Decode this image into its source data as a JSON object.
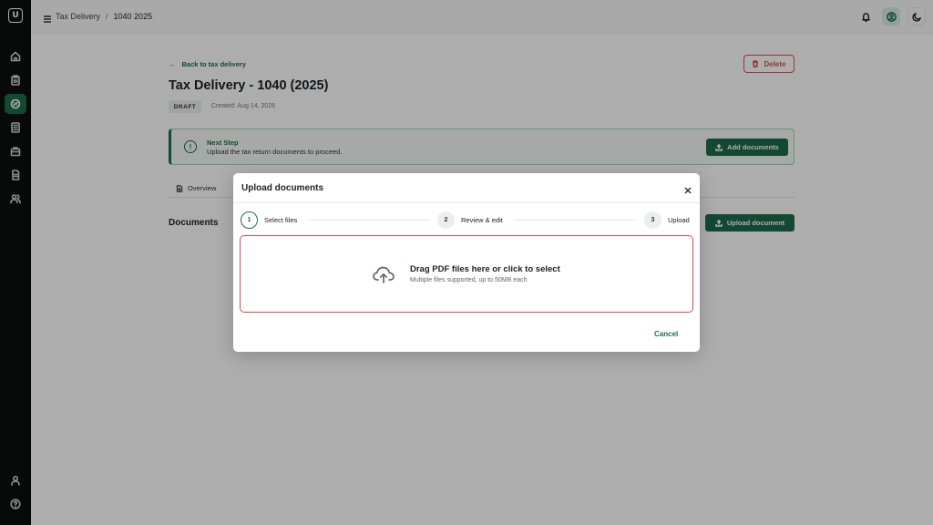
{
  "sidebar": {
    "logo_letter": "U",
    "items": [
      {
        "icon": "home-icon"
      },
      {
        "icon": "clipboard-icon"
      },
      {
        "icon": "tax-delivery-icon"
      },
      {
        "icon": "calculator-icon"
      },
      {
        "icon": "briefcase-icon"
      },
      {
        "icon": "document-icon"
      },
      {
        "icon": "users-icon"
      }
    ],
    "bottom": [
      {
        "icon": "user-icon"
      },
      {
        "icon": "help-icon"
      }
    ]
  },
  "topbar": {
    "breadcrumb_parent": "Tax Delivery",
    "breadcrumb_separator": "/",
    "breadcrumb_current": "1040 2025"
  },
  "page": {
    "back_link": "Back to tax delivery",
    "delete_label": "Delete",
    "title": "Tax Delivery - 1040 (2025)",
    "status_badge": "DRAFT",
    "created": "Created: Aug 14, 2026",
    "next_step_title": "Next Step",
    "next_step_text": "Upload the tax return documents to proceed.",
    "add_documents_label": "Add documents",
    "tab_overview": "Overview",
    "documents_heading": "Documents",
    "upload_document_label": "Upload document"
  },
  "modal": {
    "title": "Upload documents",
    "steps": [
      {
        "number": "1",
        "label": "Select files"
      },
      {
        "number": "2",
        "label": "Review & edit"
      },
      {
        "number": "3",
        "label": "Upload"
      }
    ],
    "dropzone_main": "Drag PDF files here or click to select",
    "dropzone_sub": "Multiple files supported, up to 50MB each",
    "cancel_label": "Cancel"
  },
  "colors": {
    "accent": "#1d6b4e",
    "danger": "#d9534f",
    "sidebar_bg": "#0c0f0f"
  }
}
